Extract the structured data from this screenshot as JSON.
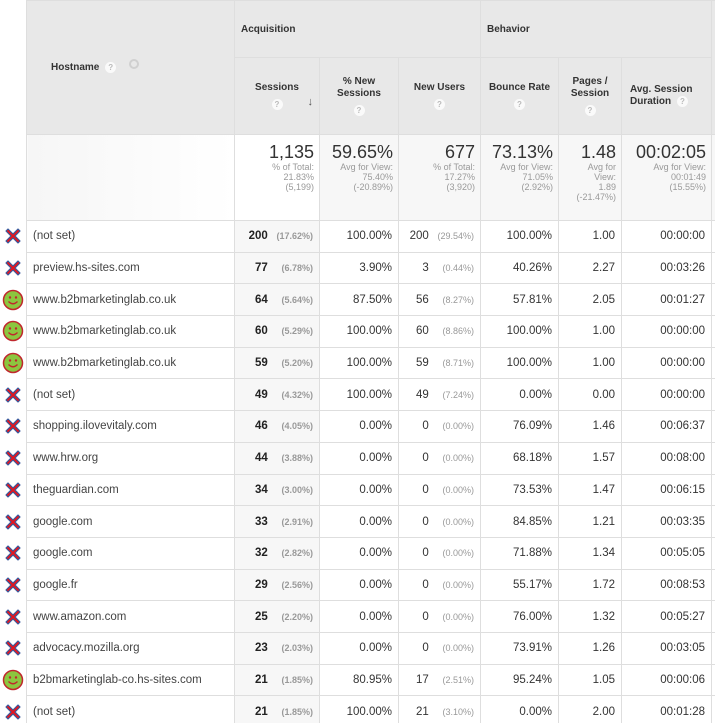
{
  "columns": {
    "hostname": "Hostname",
    "groups": {
      "acquisition": "Acquisition",
      "behavior": "Behavior"
    },
    "sessions": "Sessions",
    "pct_new_sessions": "% New Sessions",
    "new_users": "New Users",
    "bounce_rate": "Bounce Rate",
    "pages_per_session": "Pages / Session",
    "avg_session_duration": "Avg. Session Duration",
    "help_glyph": "?",
    "sort_glyph": "↓"
  },
  "summary": {
    "sessions": {
      "value": "1,135",
      "line1": "% of Total:",
      "line2": "21.83%",
      "line3": "(5,199)"
    },
    "pct_new_sessions": {
      "value": "59.65%",
      "line1": "Avg for View:",
      "line2": "75.40%",
      "line3": "(-20.89%)"
    },
    "new_users": {
      "value": "677",
      "line1": "% of Total:",
      "line2": "17.27%",
      "line3": "(3,920)"
    },
    "bounce_rate": {
      "value": "73.13%",
      "line1": "Avg for View:",
      "line2": "71.05%",
      "line3": "(2.92%)"
    },
    "pages_per_session": {
      "value": "1.48",
      "line1": "Avg for",
      "line2": "View:",
      "line3": "1.89",
      "line4": "(-21.47%)"
    },
    "avg_session_duration": {
      "value": "00:02:05",
      "line1": "Avg for View:",
      "line2": "00:01:49",
      "line3": "(15.55%)"
    }
  },
  "rows": [
    {
      "status": "invalid",
      "hostname": "(not set)",
      "sessions": "200",
      "sessions_pct": "(17.62%)",
      "pct_new": "100.00%",
      "new_users": "200",
      "new_users_pct": "(29.54%)",
      "bounce": "100.00%",
      "pps": "1.00",
      "duration": "00:00:00"
    },
    {
      "status": "invalid",
      "hostname": "preview.hs-sites.com",
      "sessions": "77",
      "sessions_pct": "(6.78%)",
      "pct_new": "3.90%",
      "new_users": "3",
      "new_users_pct": "(0.44%)",
      "bounce": "40.26%",
      "pps": "2.27",
      "duration": "00:03:26"
    },
    {
      "status": "valid",
      "hostname": "www.b2bmarketinglab.co.uk",
      "sessions": "64",
      "sessions_pct": "(5.64%)",
      "pct_new": "87.50%",
      "new_users": "56",
      "new_users_pct": "(8.27%)",
      "bounce": "57.81%",
      "pps": "2.05",
      "duration": "00:01:27"
    },
    {
      "status": "valid",
      "hostname": "www.b2bmarketinglab.co.uk",
      "sessions": "60",
      "sessions_pct": "(5.29%)",
      "pct_new": "100.00%",
      "new_users": "60",
      "new_users_pct": "(8.86%)",
      "bounce": "100.00%",
      "pps": "1.00",
      "duration": "00:00:00"
    },
    {
      "status": "valid",
      "hostname": "www.b2bmarketinglab.co.uk",
      "sessions": "59",
      "sessions_pct": "(5.20%)",
      "pct_new": "100.00%",
      "new_users": "59",
      "new_users_pct": "(8.71%)",
      "bounce": "100.00%",
      "pps": "1.00",
      "duration": "00:00:00"
    },
    {
      "status": "invalid",
      "hostname": "(not set)",
      "sessions": "49",
      "sessions_pct": "(4.32%)",
      "pct_new": "100.00%",
      "new_users": "49",
      "new_users_pct": "(7.24%)",
      "bounce": "0.00%",
      "pps": "0.00",
      "duration": "00:00:00"
    },
    {
      "status": "invalid",
      "hostname": "shopping.ilovevitaly.com",
      "sessions": "46",
      "sessions_pct": "(4.05%)",
      "pct_new": "0.00%",
      "new_users": "0",
      "new_users_pct": "(0.00%)",
      "bounce": "76.09%",
      "pps": "1.46",
      "duration": "00:06:37"
    },
    {
      "status": "invalid",
      "hostname": "www.hrw.org",
      "sessions": "44",
      "sessions_pct": "(3.88%)",
      "pct_new": "0.00%",
      "new_users": "0",
      "new_users_pct": "(0.00%)",
      "bounce": "68.18%",
      "pps": "1.57",
      "duration": "00:08:00"
    },
    {
      "status": "invalid",
      "hostname": "theguardian.com",
      "sessions": "34",
      "sessions_pct": "(3.00%)",
      "pct_new": "0.00%",
      "new_users": "0",
      "new_users_pct": "(0.00%)",
      "bounce": "73.53%",
      "pps": "1.47",
      "duration": "00:06:15"
    },
    {
      "status": "invalid",
      "hostname": "google.com",
      "sessions": "33",
      "sessions_pct": "(2.91%)",
      "pct_new": "0.00%",
      "new_users": "0",
      "new_users_pct": "(0.00%)",
      "bounce": "84.85%",
      "pps": "1.21",
      "duration": "00:03:35"
    },
    {
      "status": "invalid",
      "hostname": "google.com",
      "sessions": "32",
      "sessions_pct": "(2.82%)",
      "pct_new": "0.00%",
      "new_users": "0",
      "new_users_pct": "(0.00%)",
      "bounce": "71.88%",
      "pps": "1.34",
      "duration": "00:05:05"
    },
    {
      "status": "invalid",
      "hostname": "google.fr",
      "sessions": "29",
      "sessions_pct": "(2.56%)",
      "pct_new": "0.00%",
      "new_users": "0",
      "new_users_pct": "(0.00%)",
      "bounce": "55.17%",
      "pps": "1.72",
      "duration": "00:08:53"
    },
    {
      "status": "invalid",
      "hostname": "www.amazon.com",
      "sessions": "25",
      "sessions_pct": "(2.20%)",
      "pct_new": "0.00%",
      "new_users": "0",
      "new_users_pct": "(0.00%)",
      "bounce": "76.00%",
      "pps": "1.32",
      "duration": "00:05:27"
    },
    {
      "status": "invalid",
      "hostname": "advocacy.mozilla.org",
      "sessions": "23",
      "sessions_pct": "(2.03%)",
      "pct_new": "0.00%",
      "new_users": "0",
      "new_users_pct": "(0.00%)",
      "bounce": "73.91%",
      "pps": "1.26",
      "duration": "00:03:05"
    },
    {
      "status": "valid",
      "hostname": "b2bmarketinglab-co.hs-sites.com",
      "sessions": "21",
      "sessions_pct": "(1.85%)",
      "pct_new": "80.95%",
      "new_users": "17",
      "new_users_pct": "(2.51%)",
      "bounce": "95.24%",
      "pps": "1.05",
      "duration": "00:00:06"
    },
    {
      "status": "invalid",
      "hostname": "(not set)",
      "sessions": "21",
      "sessions_pct": "(1.85%)",
      "pct_new": "100.00%",
      "new_users": "21",
      "new_users_pct": "(3.10%)",
      "bounce": "0.00%",
      "pps": "2.00",
      "duration": "00:01:28"
    }
  ],
  "icons": {
    "valid": "smiley-face-icon",
    "invalid": "red-x-icon"
  },
  "colors": {
    "cross_red": "#e8141b",
    "cross_outline": "#3a5a9c",
    "smiley_green": "#8cc63f",
    "smiley_outline": "#c0272d",
    "header_bg": "#e8e8e8",
    "border": "#dedede"
  }
}
